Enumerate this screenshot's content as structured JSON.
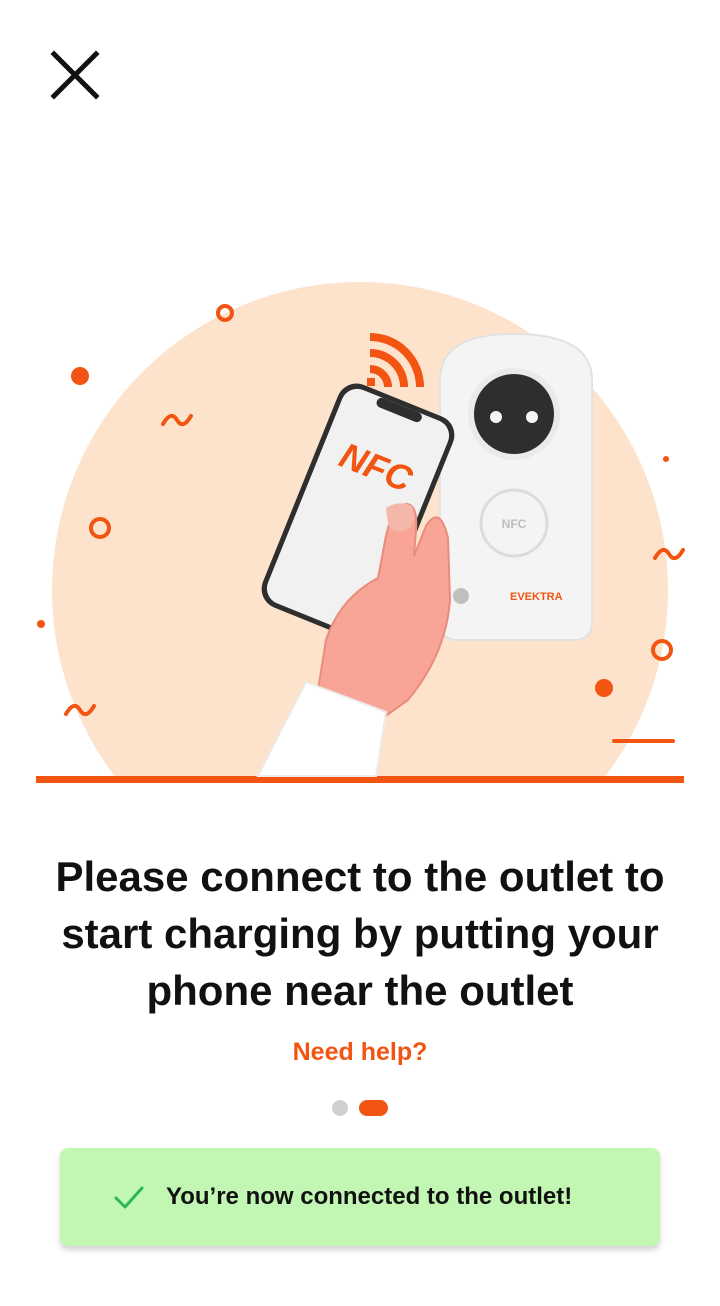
{
  "header": {
    "close_icon": "close-icon"
  },
  "illustration": {
    "phone_label": "NFC",
    "outlet_nfc_label": "NFC",
    "outlet_brand": "EVEKTRA",
    "colors": {
      "accent": "#f25412",
      "circle": "#fde3cc",
      "skin": "#f8a597"
    }
  },
  "main": {
    "headline": "Please connect to the outlet to start charging by putting your phone near the outlet",
    "help_link": "Need help?"
  },
  "pager": {
    "total": 2,
    "current": 2
  },
  "toast": {
    "icon": "checkmark-icon",
    "message": "You’re now connected to the outlet!"
  }
}
